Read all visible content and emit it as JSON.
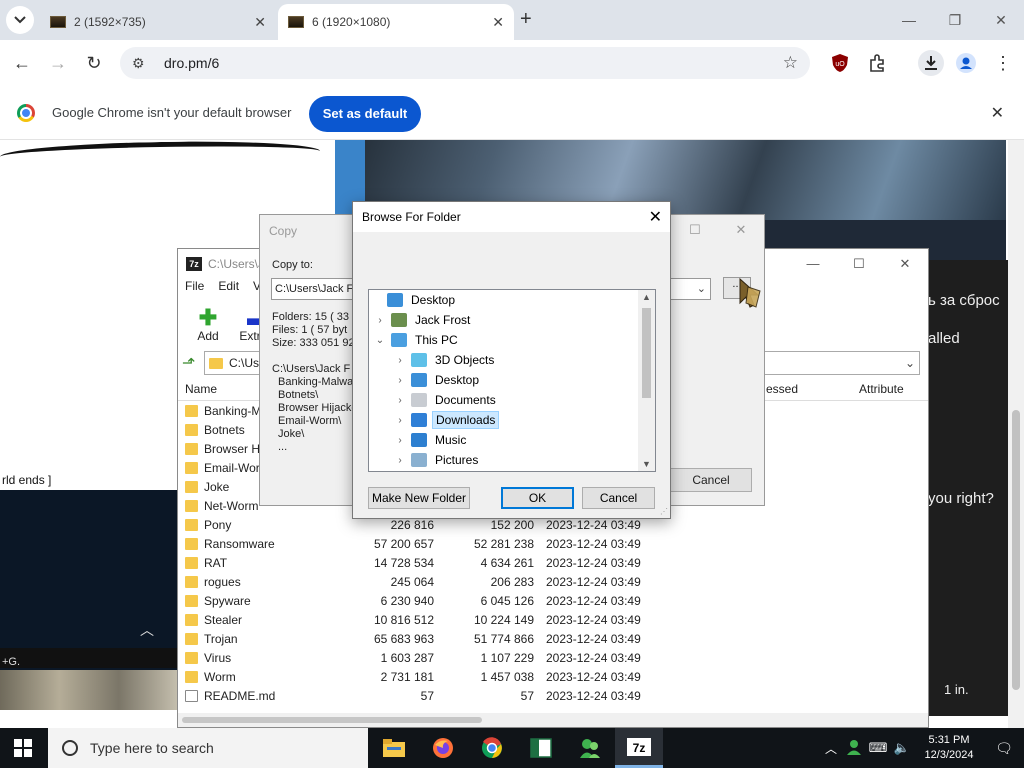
{
  "browser": {
    "tabs": [
      {
        "title": "2 (1592×735)"
      },
      {
        "title": "6 (1920×1080)"
      }
    ],
    "address": "dro.pm/6",
    "infobar": {
      "message": "Google Chrome isn't your default browser",
      "button": "Set as default"
    }
  },
  "page": {
    "left_band_text": "rld ends ]",
    "left_hint_text": "+G.",
    "right_texts": [
      "ь за сброс",
      "alled",
      "you right?",
      "1 in."
    ]
  },
  "sevenzip": {
    "title": "C:\\Users\\J",
    "menu": [
      "File",
      "Edit",
      "Vi"
    ],
    "tools": [
      {
        "label": "Add"
      },
      {
        "label": "Extract"
      }
    ],
    "address": "C:\\Us",
    "columns": [
      "Name",
      "essed",
      "Attribute"
    ],
    "rows": [
      {
        "name": "Banking-M",
        "size": "",
        "packed": "",
        "modified": ""
      },
      {
        "name": "Botnets",
        "size": "",
        "packed": "",
        "modified": ""
      },
      {
        "name": "Browser Hij",
        "size": "",
        "packed": "",
        "modified": ""
      },
      {
        "name": "Email-Worr",
        "size": "",
        "packed": "",
        "modified": ""
      },
      {
        "name": "Joke",
        "size": "",
        "packed": "",
        "modified": ""
      },
      {
        "name": "Net-Worm",
        "size": "",
        "packed": "",
        "modified": ""
      },
      {
        "name": "Pony",
        "size": "226 816",
        "packed": "152 200",
        "modified": "2023-12-24 03:49"
      },
      {
        "name": "Ransomware",
        "size": "57 200 657",
        "packed": "52 281 238",
        "modified": "2023-12-24 03:49"
      },
      {
        "name": "RAT",
        "size": "14 728 534",
        "packed": "4 634 261",
        "modified": "2023-12-24 03:49"
      },
      {
        "name": "rogues",
        "size": "245 064",
        "packed": "206 283",
        "modified": "2023-12-24 03:49"
      },
      {
        "name": "Spyware",
        "size": "6 230 940",
        "packed": "6 045 126",
        "modified": "2023-12-24 03:49"
      },
      {
        "name": "Stealer",
        "size": "10 816 512",
        "packed": "10 224 149",
        "modified": "2023-12-24 03:49"
      },
      {
        "name": "Trojan",
        "size": "65 683 963",
        "packed": "51 774 866",
        "modified": "2023-12-24 03:49"
      },
      {
        "name": "Virus",
        "size": "1 603 287",
        "packed": "1 107 229",
        "modified": "2023-12-24 03:49"
      },
      {
        "name": "Worm",
        "size": "2 731 181",
        "packed": "1 457 038",
        "modified": "2023-12-24 03:49"
      },
      {
        "name": "README.md",
        "size": "57",
        "packed": "57",
        "modified": "2023-12-24 03:49",
        "file": true
      }
    ]
  },
  "copy_dialog": {
    "title": "Copy",
    "label": "Copy to:",
    "path": "C:\\Users\\Jack F",
    "browse": "...",
    "stats": [
      "Folders: 15    ( 33",
      "Files: 1    ( 57 byt",
      "Size: 333 051 92"
    ],
    "list_head": "C:\\Users\\Jack F",
    "list_items": [
      "Banking-Malwa",
      "Botnets\\",
      "Browser Hijacke",
      "Email-Worm\\",
      "Joke\\",
      "..."
    ],
    "cancel": "Cancel"
  },
  "browse_dialog": {
    "title": "Browse For Folder",
    "tree": [
      {
        "label": "Desktop",
        "level": 0,
        "expander": "",
        "icon": "desktop-icon",
        "color": "#3b8fd8"
      },
      {
        "label": "Jack Frost",
        "level": 1,
        "expander": ">",
        "icon": "user-icon",
        "color": "#6b8f4e"
      },
      {
        "label": "This PC",
        "level": 1,
        "expander": "v",
        "icon": "computer-icon",
        "color": "#4a9fe0"
      },
      {
        "label": "3D Objects",
        "level": 2,
        "expander": ">",
        "icon": "cube-icon",
        "color": "#5ec0e8"
      },
      {
        "label": "Desktop",
        "level": 2,
        "expander": ">",
        "icon": "desktop-icon",
        "color": "#3b8fd8"
      },
      {
        "label": "Documents",
        "level": 2,
        "expander": ">",
        "icon": "document-icon",
        "color": "#c8ccd2"
      },
      {
        "label": "Downloads",
        "level": 2,
        "expander": ">",
        "icon": "download-icon",
        "color": "#2f7fd6",
        "selected": true
      },
      {
        "label": "Music",
        "level": 2,
        "expander": ">",
        "icon": "music-icon",
        "color": "#2d7fd0"
      },
      {
        "label": "Pictures",
        "level": 2,
        "expander": ">",
        "icon": "pictures-icon",
        "color": "#8ab0d0"
      }
    ],
    "buttons": {
      "new_folder": "Make New Folder",
      "ok": "OK",
      "cancel": "Cancel"
    }
  },
  "taskbar": {
    "search_placeholder": "Type here to search",
    "time": "5:31 PM",
    "date": "12/3/2024"
  }
}
